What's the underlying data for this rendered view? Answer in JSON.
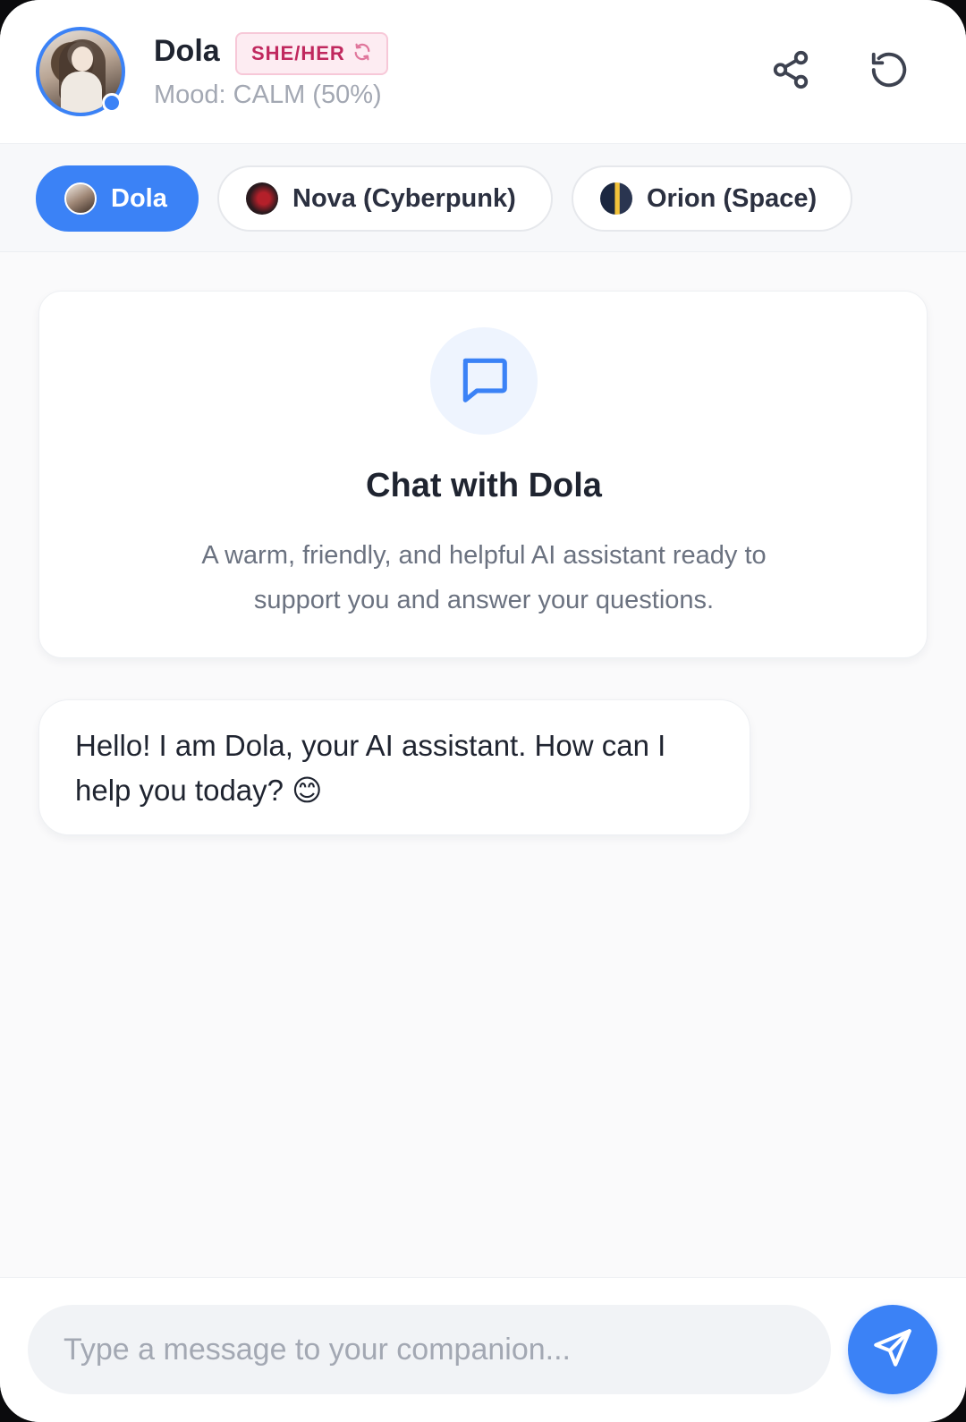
{
  "header": {
    "name": "Dola",
    "pronoun_badge": "SHE/HER",
    "mood": "Mood: CALM (50%)",
    "accent_color": "#3b82f6",
    "badge_color": "#c0285e"
  },
  "tabs": [
    {
      "label": "Dola",
      "active": true
    },
    {
      "label": "Nova (Cyberpunk)",
      "active": false
    },
    {
      "label": "Orion (Space)",
      "active": false
    }
  ],
  "intro": {
    "icon": "chat-bubble-icon",
    "title": "Chat with Dola",
    "description": "A warm, friendly, and helpful AI assistant ready to support you and answer your questions."
  },
  "messages": [
    {
      "sender": "Dola",
      "text": "Hello! I am Dola, your AI assistant. How can I help you today? 😊"
    }
  ],
  "composer": {
    "placeholder": "Type a message to your companion...",
    "value": ""
  },
  "icons": {
    "share": "share-icon",
    "reset": "reset-icon",
    "send": "send-icon",
    "swap": "refresh-icon"
  }
}
